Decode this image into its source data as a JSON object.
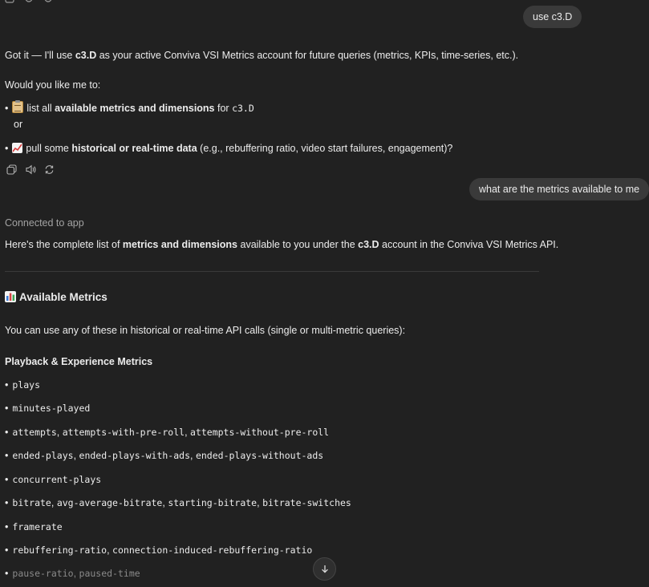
{
  "user_messages": [
    "use c3.D",
    "what are the metrics available to me"
  ],
  "response1": {
    "intro_pre": "Got it — I'll use ",
    "intro_bold": "c3.D",
    "intro_post": " as your active Conviva VSI Metrics account for future queries (metrics, KPIs, time-series, etc.).",
    "question": "Would you like me to:",
    "option1_pre": "list all ",
    "option1_bold": "available metrics and dimensions",
    "option1_post": " for ",
    "option1_code": "c3.D",
    "or_text": "or",
    "option2_pre": "pull some ",
    "option2_bold": "historical or real-time data",
    "option2_post": " (e.g., rebuffering ratio, video start failures, engagement)?",
    "action_icons": [
      "copy-icon",
      "speaker-icon",
      "regenerate-icon"
    ]
  },
  "response2": {
    "connected": "Connected to app",
    "intro_pre": "Here's the complete list of ",
    "intro_bold": "metrics and dimensions",
    "intro_mid": " available to you under the ",
    "intro_bold2": "c3.D",
    "intro_post": " account in the Conviva VSI Metrics API.",
    "heading": "Available Metrics",
    "desc": "You can use any of these in historical or real-time API calls (single or multi-metric queries):",
    "subheading": "Playback & Experience Metrics",
    "metrics": [
      [
        "plays"
      ],
      [
        "minutes-played"
      ],
      [
        "attempts",
        "attempts-with-pre-roll",
        "attempts-without-pre-roll"
      ],
      [
        "ended-plays",
        "ended-plays-with-ads",
        "ended-plays-without-ads"
      ],
      [
        "concurrent-plays"
      ],
      [
        "bitrate",
        "avg-average-bitrate",
        "starting-bitrate",
        "bitrate-switches"
      ],
      [
        "framerate"
      ],
      [
        "rebuffering-ratio",
        "connection-induced-rebuffering-ratio"
      ],
      [
        "pause-ratio",
        "paused-time"
      ]
    ]
  },
  "bullet_char": "•",
  "separator": ", "
}
